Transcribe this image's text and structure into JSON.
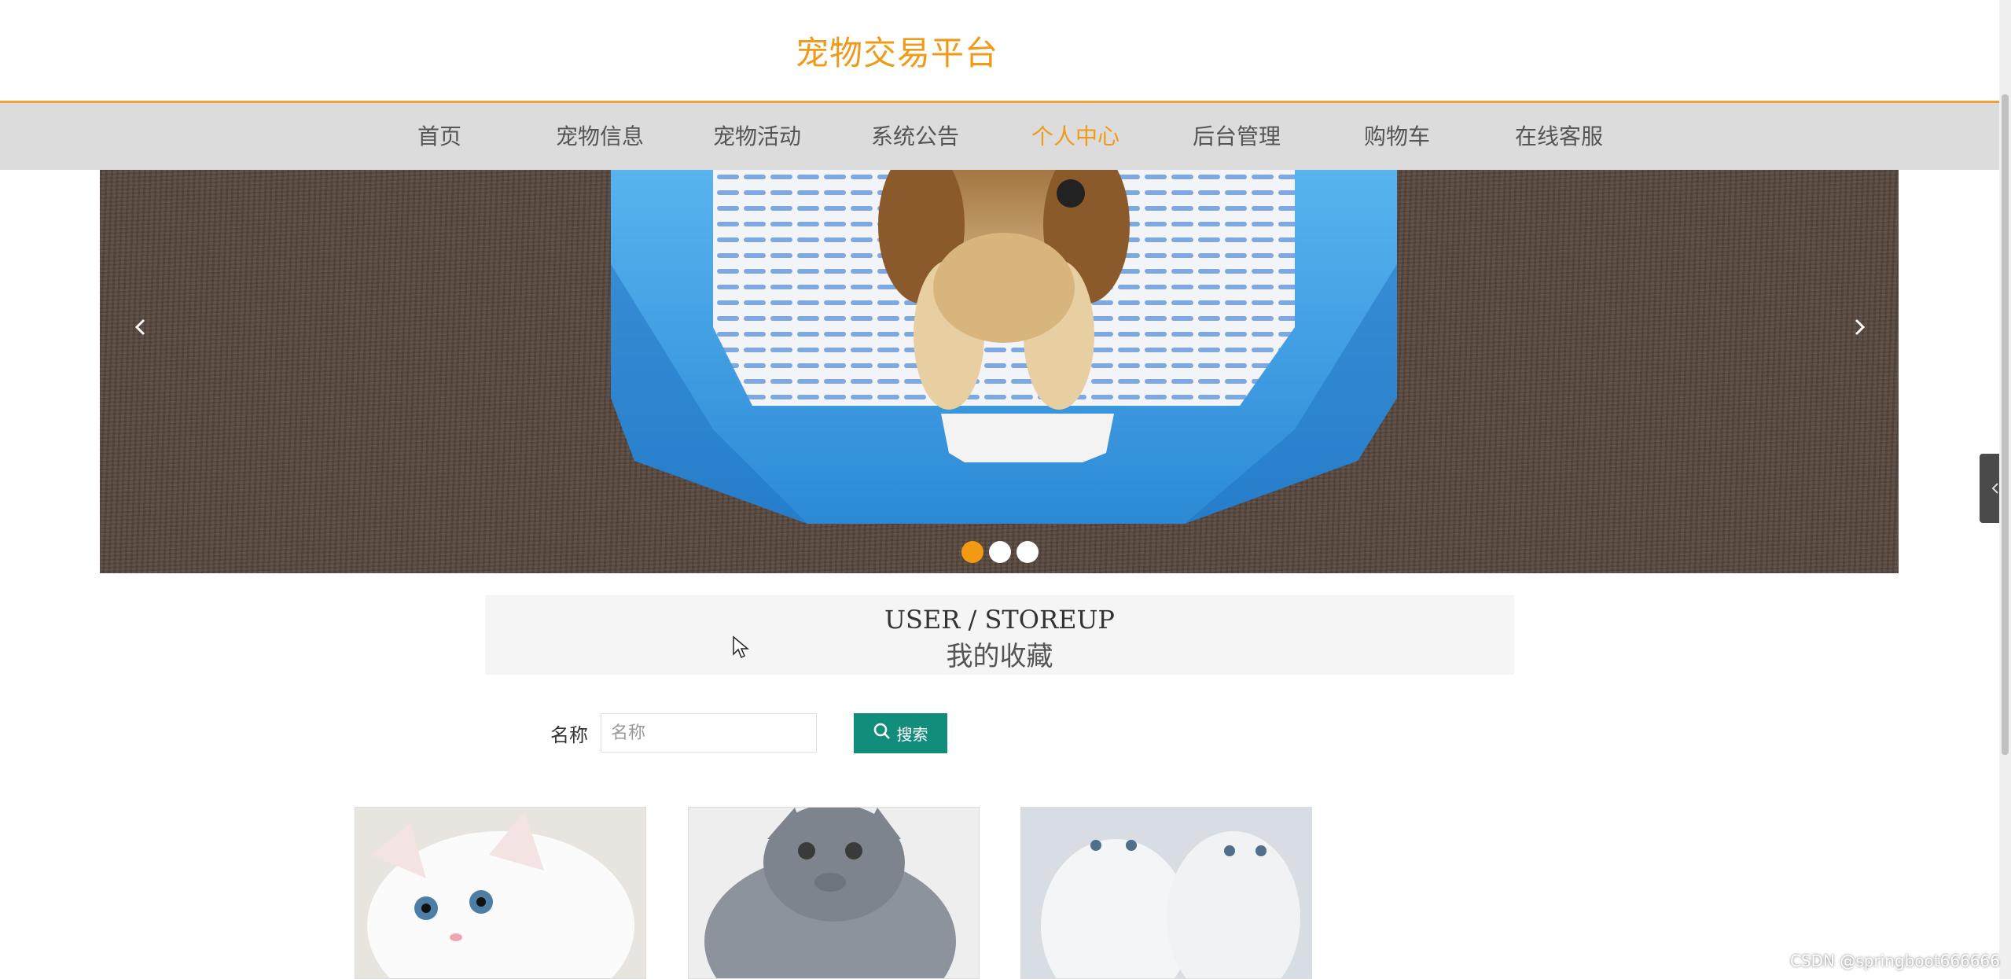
{
  "site": {
    "title": "宠物交易平台"
  },
  "nav": {
    "items": [
      {
        "label": "首页",
        "active": false
      },
      {
        "label": "宠物信息",
        "active": false
      },
      {
        "label": "宠物活动",
        "active": false
      },
      {
        "label": "系统公告",
        "active": false
      },
      {
        "label": "个人中心",
        "active": true
      },
      {
        "label": "后台管理",
        "active": false
      },
      {
        "label": "购物车",
        "active": false
      },
      {
        "label": "在线客服",
        "active": false
      }
    ],
    "active_color": "#f09a1a"
  },
  "banner": {
    "prev_icon": "chevron-left-icon",
    "next_icon": "chevron-right-icon",
    "active_slide": 1,
    "slide_count": 3,
    "image": "puppy in blue pet toilet tray on carpet"
  },
  "section": {
    "title_en": "USER / STOREUP",
    "title_zh": "我的收藏"
  },
  "search": {
    "label": "名称",
    "placeholder": "名称",
    "value": "",
    "button_label": "搜索",
    "button_icon": "search-icon",
    "button_color": "#128d7c"
  },
  "cards": [
    {
      "image": "white kitten"
    },
    {
      "image": "grey kitten"
    },
    {
      "image": "two white kittens"
    }
  ],
  "side_toggle_icon": "chevron-left-icon",
  "watermark": "CSDN @springboot666666"
}
